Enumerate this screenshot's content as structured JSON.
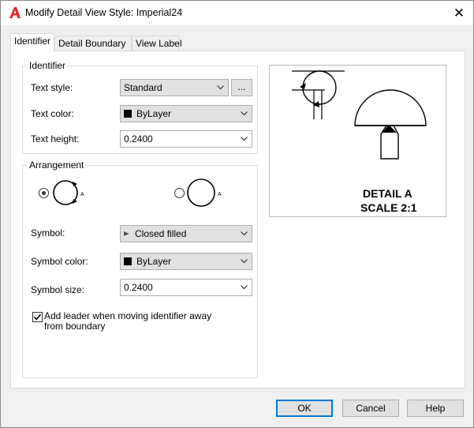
{
  "window": {
    "title": "Modify Detail View Style: Imperial24",
    "close_glyph": "✕",
    "accent_color": "#0078d7",
    "app_icon": "autocad-a-icon"
  },
  "tabs": [
    {
      "label": "Identifier",
      "active": true
    },
    {
      "label": "Detail Boundary",
      "active": false
    },
    {
      "label": "View Label",
      "active": false
    }
  ],
  "identifier_group": {
    "legend": "Identifier",
    "text_style": {
      "label": "Text style:",
      "value": "Standard",
      "browse_label": "..."
    },
    "text_color": {
      "label": "Text color:",
      "value": "ByLayer"
    },
    "text_height": {
      "label": "Text height:",
      "value": "0.2400"
    }
  },
  "arrangement_group": {
    "legend": "Arrangement",
    "option1_letter": "A",
    "option2_letter": "A",
    "selected_option": 1,
    "symbol": {
      "label": "Symbol:",
      "value": "Closed filled"
    },
    "symbol_color": {
      "label": "Symbol color:",
      "value": "ByLayer"
    },
    "symbol_size": {
      "label": "Symbol size:",
      "value": "0.2400"
    },
    "leader_checkbox": {
      "label": "Add leader when moving identifier away from boundary",
      "checked": true
    }
  },
  "preview": {
    "line1": "DETAIL A",
    "line2": "SCALE 2:1"
  },
  "buttons": {
    "ok": "OK",
    "cancel": "Cancel",
    "help": "Help"
  }
}
